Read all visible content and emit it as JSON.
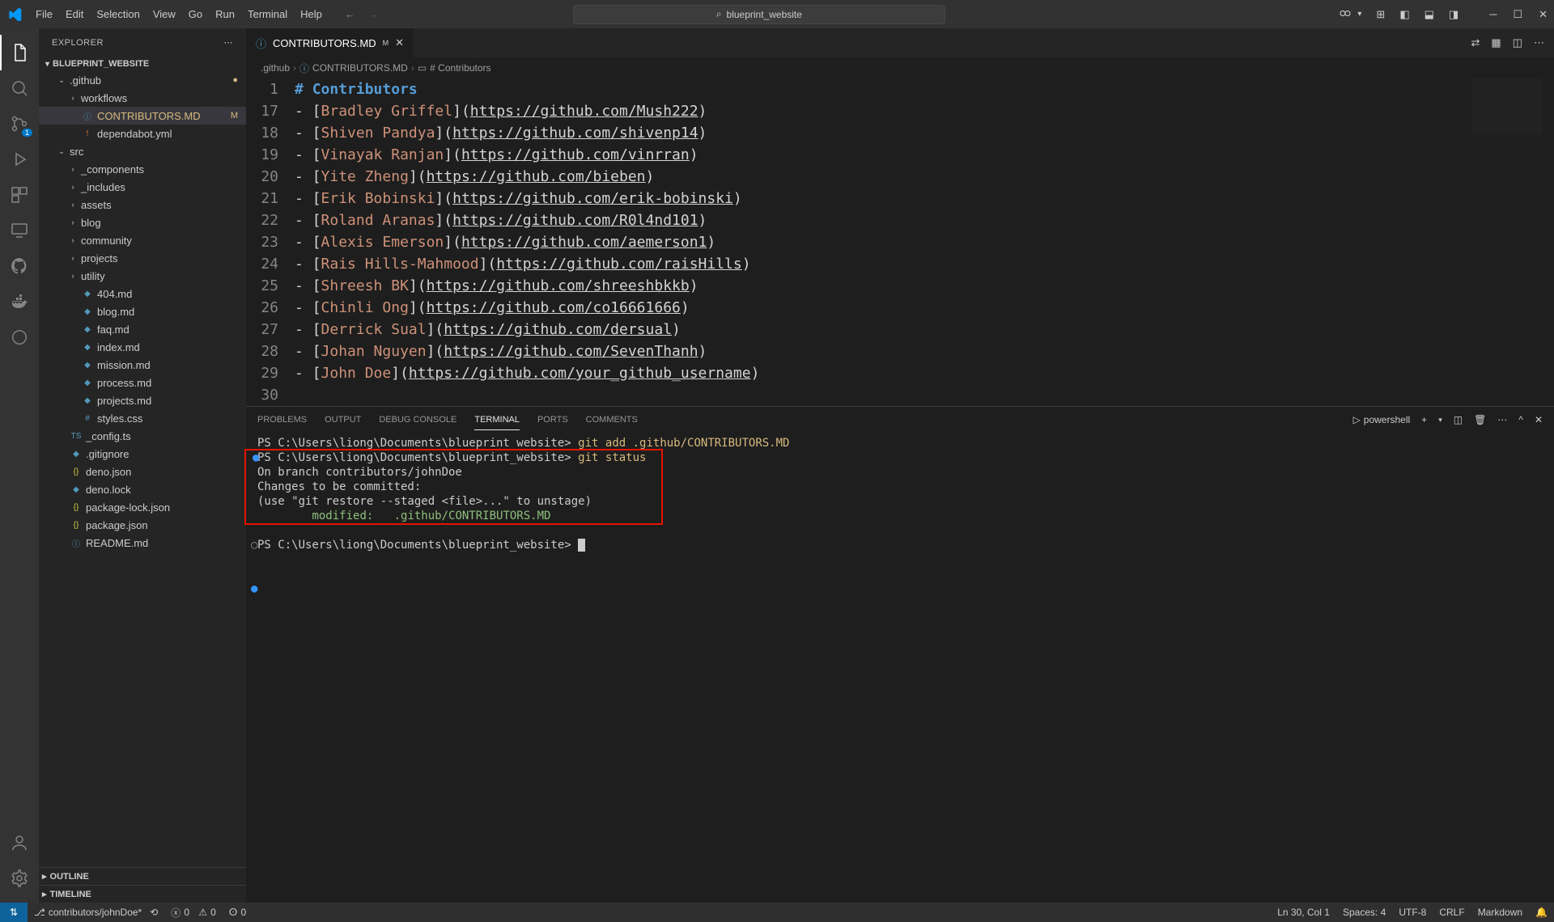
{
  "titlebar": {
    "menu": [
      "File",
      "Edit",
      "Selection",
      "View",
      "Go",
      "Run",
      "Terminal",
      "Help"
    ],
    "search_text": "blueprint_website"
  },
  "activity": {
    "scm_badge": "1"
  },
  "sidebar": {
    "title": "EXPLORER",
    "project": "BLUEPRINT_WEBSITE",
    "tree": [
      {
        "type": "folder",
        "name": ".github",
        "depth": 1,
        "open": true,
        "status": "●"
      },
      {
        "type": "folder",
        "name": "workflows",
        "depth": 2,
        "open": false
      },
      {
        "type": "file",
        "name": "CONTRIBUTORS.MD",
        "depth": 2,
        "icon": "ⓘ",
        "active": true,
        "modified": true,
        "status": "M"
      },
      {
        "type": "file",
        "name": "dependabot.yml",
        "depth": 2,
        "icon": "!"
      },
      {
        "type": "folder",
        "name": "src",
        "depth": 1,
        "open": true
      },
      {
        "type": "folder",
        "name": "_components",
        "depth": 2,
        "open": false
      },
      {
        "type": "folder",
        "name": "_includes",
        "depth": 2,
        "open": false
      },
      {
        "type": "folder",
        "name": "assets",
        "depth": 2,
        "open": false
      },
      {
        "type": "folder",
        "name": "blog",
        "depth": 2,
        "open": false
      },
      {
        "type": "folder",
        "name": "community",
        "depth": 2,
        "open": false
      },
      {
        "type": "folder",
        "name": "projects",
        "depth": 2,
        "open": false
      },
      {
        "type": "folder",
        "name": "utility",
        "depth": 2,
        "open": false
      },
      {
        "type": "file",
        "name": "404.md",
        "depth": 2,
        "icon": "◆"
      },
      {
        "type": "file",
        "name": "blog.md",
        "depth": 2,
        "icon": "◆"
      },
      {
        "type": "file",
        "name": "faq.md",
        "depth": 2,
        "icon": "◆"
      },
      {
        "type": "file",
        "name": "index.md",
        "depth": 2,
        "icon": "◆"
      },
      {
        "type": "file",
        "name": "mission.md",
        "depth": 2,
        "icon": "◆"
      },
      {
        "type": "file",
        "name": "process.md",
        "depth": 2,
        "icon": "◆"
      },
      {
        "type": "file",
        "name": "projects.md",
        "depth": 2,
        "icon": "◆"
      },
      {
        "type": "file",
        "name": "styles.css",
        "depth": 2,
        "icon": "#"
      },
      {
        "type": "file",
        "name": "_config.ts",
        "depth": 1,
        "icon": "TS"
      },
      {
        "type": "file",
        "name": ".gitignore",
        "depth": 1,
        "icon": "◆"
      },
      {
        "type": "file",
        "name": "deno.json",
        "depth": 1,
        "icon": "{}"
      },
      {
        "type": "file",
        "name": "deno.lock",
        "depth": 1,
        "icon": "◆"
      },
      {
        "type": "file",
        "name": "package-lock.json",
        "depth": 1,
        "icon": "{}"
      },
      {
        "type": "file",
        "name": "package.json",
        "depth": 1,
        "icon": "{}"
      },
      {
        "type": "file",
        "name": "README.md",
        "depth": 1,
        "icon": "ⓘ"
      }
    ],
    "outline": "OUTLINE",
    "timeline": "TIMELINE"
  },
  "tab": {
    "icon": "ⓘ",
    "name": "CONTRIBUTORS.MD",
    "modified": "M"
  },
  "breadcrumb": {
    "parts": [
      ".github",
      "CONTRIBUTORS.MD",
      "# Contributors"
    ]
  },
  "editor": {
    "start_line": 1,
    "heading": {
      "line": 1,
      "text": "Contributors"
    },
    "entries": [
      {
        "line": 17,
        "name": "Bradley Griffel",
        "url": "https://github.com/Mush222"
      },
      {
        "line": 18,
        "name": "Shiven Pandya",
        "url": "https://github.com/shivenp14"
      },
      {
        "line": 19,
        "name": "Vinayak Ranjan",
        "url": "https://github.com/vinrran"
      },
      {
        "line": 20,
        "name": "Yite Zheng",
        "url": "https://github.com/bieben"
      },
      {
        "line": 21,
        "name": "Erik Bobinski",
        "url": "https://github.com/erik-bobinski"
      },
      {
        "line": 22,
        "name": "Roland Aranas",
        "url": "https://github.com/R0l4nd101"
      },
      {
        "line": 23,
        "name": "Alexis Emerson",
        "url": "https://github.com/aemerson1"
      },
      {
        "line": 24,
        "name": "Rais Hills-Mahmood",
        "url": "https://github.com/raisHills"
      },
      {
        "line": 25,
        "name": "Shreesh BK",
        "url": "https://github.com/shreeshbkkb"
      },
      {
        "line": 26,
        "name": "Chinli Ong",
        "url": "https://github.com/co16661666"
      },
      {
        "line": 27,
        "name": "Derrick Sual",
        "url": "https://github.com/dersual"
      },
      {
        "line": 28,
        "name": "Johan Nguyen",
        "url": "https://github.com/SevenThanh"
      },
      {
        "line": 29,
        "name": "John Doe",
        "url": "https://github.com/your_github_username"
      }
    ],
    "last_line": 30
  },
  "panel": {
    "tabs": [
      "PROBLEMS",
      "OUTPUT",
      "DEBUG CONSOLE",
      "TERMINAL",
      "PORTS",
      "COMMENTS"
    ],
    "active_tab": "TERMINAL",
    "shell": "powershell"
  },
  "terminal": {
    "line1_prompt": "PS C:\\Users\\liong\\Documents\\blueprint_website>",
    "line1_cmd": "git add .github/CONTRIBUTORS.MD",
    "line2_prompt": "PS C:\\Users\\liong\\Documents\\blueprint_website>",
    "line2_cmd": "git status",
    "line3": "On branch contributors/johnDoe",
    "line4": "Changes to be committed:",
    "line5": "  (use \"git restore --staged <file>...\" to unstage)",
    "line6_label": "modified:",
    "line6_file": ".github/CONTRIBUTORS.MD",
    "line7_prompt": "PS C:\\Users\\liong\\Documents\\blueprint_website>"
  },
  "statusbar": {
    "branch": "contributors/johnDoe*",
    "errors": "0",
    "warnings": "0",
    "port": "0",
    "pos": "Ln 30, Col 1",
    "spaces": "Spaces: 4",
    "enc": "UTF-8",
    "eol": "CRLF",
    "lang": "Markdown"
  }
}
